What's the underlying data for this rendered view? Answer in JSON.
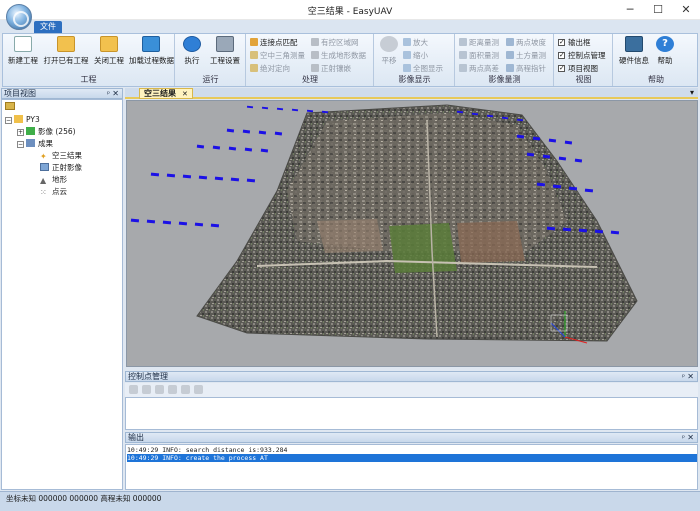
{
  "window": {
    "title": "空三结果 - EasyUAV",
    "minimize": "─",
    "maximize": "☐",
    "close": "✕"
  },
  "menu": {
    "file_tab": "文件"
  },
  "ribbon": {
    "groups": [
      {
        "label": "工程",
        "buttons": [
          "新建工程",
          "打开已有工程",
          "关闭工程",
          "加载过程数据"
        ]
      },
      {
        "label": "运行",
        "buttons": [
          "执行",
          "工程设置"
        ]
      },
      {
        "label": "处理",
        "items": [
          "连接点匹配",
          "空中三角测量",
          "绝对定向",
          "有控区域网",
          "生成地形数据",
          "正射镶嵌"
        ]
      },
      {
        "label": "影像显示",
        "items": [
          "平移",
          "放大",
          "缩小",
          "全图显示"
        ]
      },
      {
        "label": "影像量测",
        "items": [
          "距离量测",
          "两点坡度",
          "面积量测",
          "土方量测",
          "两点高差",
          "高程指针"
        ]
      },
      {
        "label": "视图",
        "items": [
          "输出框",
          "控制点管理",
          "项目视图"
        ]
      },
      {
        "label": "帮助",
        "buttons": [
          "硬件信息",
          "帮助"
        ]
      }
    ]
  },
  "project_view": {
    "title": "项目视图",
    "pin": "ᵖ",
    "close": "✕",
    "tree": {
      "root": "PY3",
      "images": "影像 (256)",
      "results": "成果",
      "children": [
        "空三结果",
        "正射影像",
        "地形",
        "点云"
      ]
    }
  },
  "document": {
    "tab_label": "空三结果",
    "tab_close": "✕",
    "dropdown": "▾"
  },
  "gcp_panel": {
    "title": "控制点管理",
    "pin": "ᵖ",
    "close": "✕"
  },
  "output_panel": {
    "title": "输出",
    "pin": "ᵖ",
    "close": "✕",
    "lines": [
      "10:49:29 INFO: search distance is:933.284",
      "10:49:29 INFO: create the process AT"
    ]
  },
  "statusbar": {
    "text": "坐标未知 000000 000000 高程未知 000000"
  },
  "colors": {
    "accent": "#2d6fc0",
    "camera_marker": "#1b10e6",
    "selection": "#1e74d8"
  }
}
